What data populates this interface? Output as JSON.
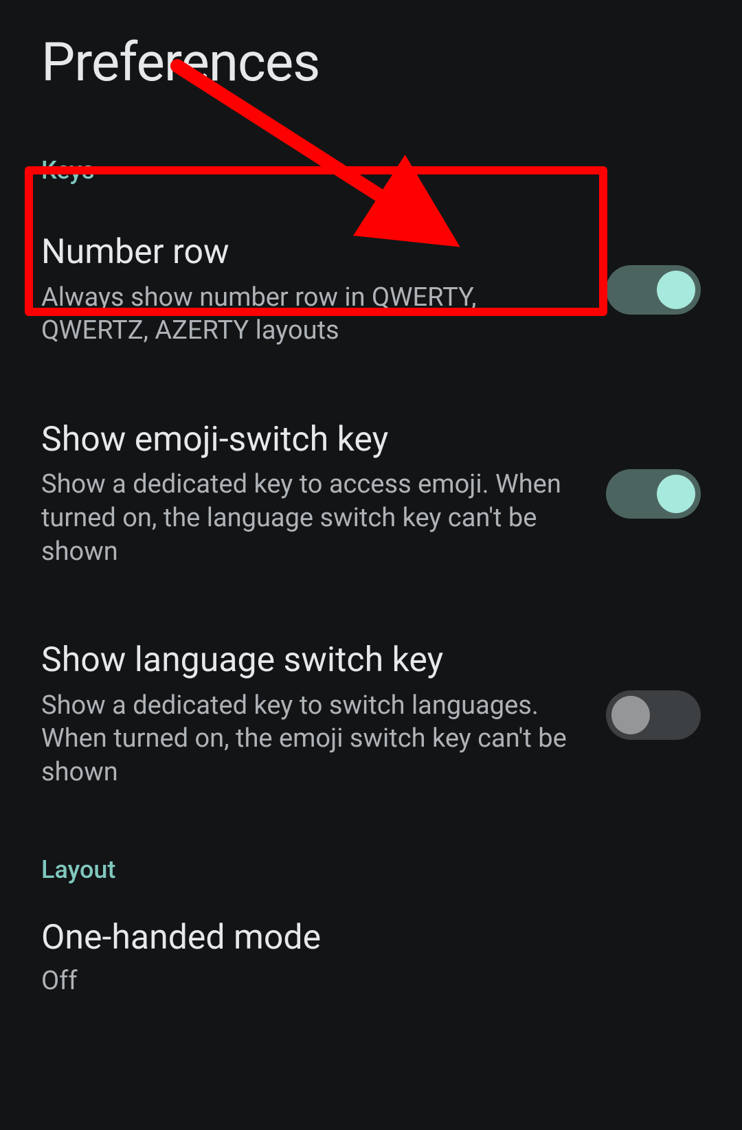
{
  "page": {
    "title": "Preferences"
  },
  "sections": {
    "keys": {
      "header": "Keys",
      "items": [
        {
          "id": "number-row",
          "title": "Number row",
          "description": "Always show number row in QWERTY, QWERTZ, AZERTY layouts",
          "toggle": "on"
        },
        {
          "id": "emoji-switch",
          "title": "Show emoji-switch key",
          "description": "Show a dedicated key to access emoji. When turned on, the language switch key can't be shown",
          "toggle": "on"
        },
        {
          "id": "language-switch",
          "title": "Show language switch key",
          "description": "Show a dedicated key to switch languages. When turned on, the emoji switch key can't be shown",
          "toggle": "off"
        }
      ]
    },
    "layout": {
      "header": "Layout",
      "items": [
        {
          "id": "one-handed",
          "title": "One-handed mode",
          "value": "Off"
        }
      ]
    }
  },
  "annotation": {
    "highlight_target": "number-row",
    "colors": {
      "annotation": "#ff0000",
      "accent_on": "#a7e9dc",
      "track_on": "#4c645f",
      "track_off": "#3d4043"
    }
  }
}
